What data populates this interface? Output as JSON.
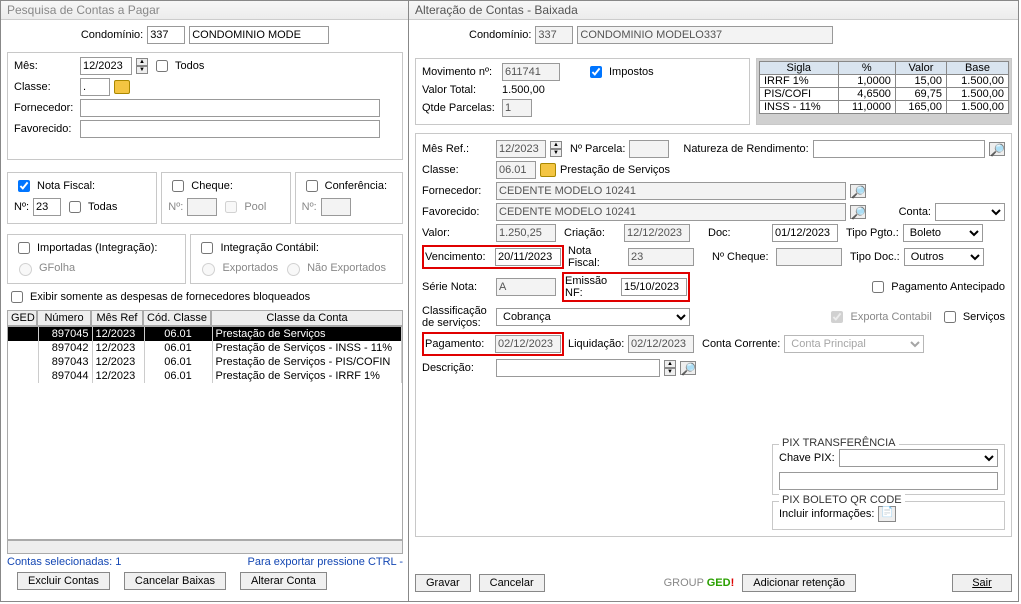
{
  "leftWindow": {
    "title": "Pesquisa de Contas a Pagar",
    "condominio_label": "Condomínio:",
    "condominio_num": "337",
    "condominio_nome": "CONDOMINIO MODE",
    "mes_label": "Mês:",
    "mes_value": "12/2023",
    "todos": "Todos",
    "classe_label": "Classe:",
    "classe_value": ".",
    "fornecedor_label": "Fornecedor:",
    "fornecedor_value": "",
    "favorecido_label": "Favorecido:",
    "favorecido_value": "",
    "notafiscal": "Nota Fiscal:",
    "no_label": "Nº:",
    "no_val": "23",
    "todas": "Todas",
    "cheque": "Cheque:",
    "cheque_no": "Nº:",
    "pool": "Pool",
    "conferencia": "Conferência:",
    "conf_no": "Nº:",
    "importadas": "Importadas (Integração):",
    "gfolha": "GFolha",
    "integ_contabil": "Integração Contábil:",
    "exportados": "Exportados",
    "nao_exportados": "Não Exportados",
    "exibir_bloqueados": "Exibir somente as despesas de fornecedores bloqueados",
    "grid_headers": [
      "GED",
      "Número",
      "Mês Ref",
      "Cód. Classe",
      "Classe da Conta"
    ],
    "grid_rows": [
      {
        "num": "897045",
        "mes": "12/2023",
        "cod": "06.01",
        "classe": "Prestação de Serviços",
        "sel": true
      },
      {
        "num": "897042",
        "mes": "12/2023",
        "cod": "06.01",
        "classe": "Prestação de Serviços - INSS - 11%"
      },
      {
        "num": "897043",
        "mes": "12/2023",
        "cod": "06.01",
        "classe": "Prestação de Serviços - PIS/COFIN"
      },
      {
        "num": "897044",
        "mes": "12/2023",
        "cod": "06.01",
        "classe": "Prestação de Serviços - IRRF 1%"
      }
    ],
    "status_contas": "Contas selecionadas: 1",
    "status_export": "Para exportar pressione CTRL -",
    "btn_excluir": "Excluir Contas",
    "btn_cancelar": "Cancelar Baixas",
    "btn_alterar": "Alterar Conta"
  },
  "rightWindow": {
    "title": "Alteração de Contas - Baixada",
    "condominio_label": "Condomínio:",
    "condominio_num": "337",
    "condominio_nome": "CONDOMINIO MODELO337",
    "mov_no_label": "Movimento nº:",
    "mov_no": "611741",
    "impostos": "Impostos",
    "valor_total_label": "Valor Total:",
    "valor_total": "1.500,00",
    "qtde_parcelas_label": "Qtde Parcelas:",
    "qtde_parcelas": "1",
    "tax_headers": [
      "Sigla",
      "%",
      "Valor",
      "Base"
    ],
    "tax_rows": [
      {
        "sigla": "IRRF 1%",
        "pct": "1,0000",
        "valor": "15,00",
        "base": "1.500,00"
      },
      {
        "sigla": "PIS/COFI",
        "pct": "4,6500",
        "valor": "69,75",
        "base": "1.500,00"
      },
      {
        "sigla": "INSS - 11%",
        "pct": "11,0000",
        "valor": "165,00",
        "base": "1.500,00"
      }
    ],
    "mes_ref_label": "Mês Ref.:",
    "mes_ref": "12/2023",
    "no_parcela_label": "Nº Parcela:",
    "no_parcela": "",
    "natureza_label": "Natureza de Rendimento:",
    "natureza": "",
    "classe_label": "Classe:",
    "classe_cod": "06.01",
    "classe_nome": "Prestação de Serviços",
    "fornecedor_label": "Fornecedor:",
    "fornecedor": "CEDENTE MODELO 10241",
    "favorecido_label": "Favorecido:",
    "favorecido": "CEDENTE MODELO 10241",
    "conta_label": "Conta:",
    "valor_label": "Valor:",
    "valor": "1.250,25",
    "criacao_label": "Criação:",
    "criacao": "12/12/2023",
    "doc_label": "Doc:",
    "doc": "01/12/2023",
    "tipo_pgto_label": "Tipo Pgto.:",
    "tipo_pgto": "Boleto",
    "vencimento_label": "Vencimento:",
    "vencimento": "20/11/2023",
    "nota_fiscal_label": "Nota Fiscal:",
    "nota_fiscal": "23",
    "no_cheque_label": "Nº Cheque:",
    "no_cheque": "",
    "tipo_doc_label": "Tipo Doc.:",
    "tipo_doc": "Outros",
    "serie_nota_label": "Série Nota:",
    "serie_nota": "A",
    "emissao_nf_label": "Emissão NF:",
    "emissao_nf": "15/10/2023",
    "pagamento_antecipado": "Pagamento Antecipado",
    "classificacao_label": "Classificação de serviços:",
    "classificacao": "Cobrança",
    "exporta_contabil": "Exporta Contabil",
    "servicos": "Serviços",
    "pagamento_label": "Pagamento:",
    "pagamento": "02/12/2023",
    "liquidacao_label": "Liquidação:",
    "liquidacao": "02/12/2023",
    "conta_corrente_label": "Conta Corrente:",
    "conta_corrente": "Conta Principal",
    "descricao_label": "Descrição:",
    "descricao": "",
    "pix_transf": "PIX TRANSFERÊNCIA",
    "chave_pix_label": "Chave PIX:",
    "chave_pix": "",
    "pix_boleto": "PIX BOLETO QR CODE",
    "incluir_info": "Incluir informações:",
    "btn_gravar": "Gravar",
    "btn_cancelar": "Cancelar",
    "ged": "GROUP GED!",
    "btn_adicionar": "Adicionar retenção",
    "btn_sair": "Sair"
  }
}
